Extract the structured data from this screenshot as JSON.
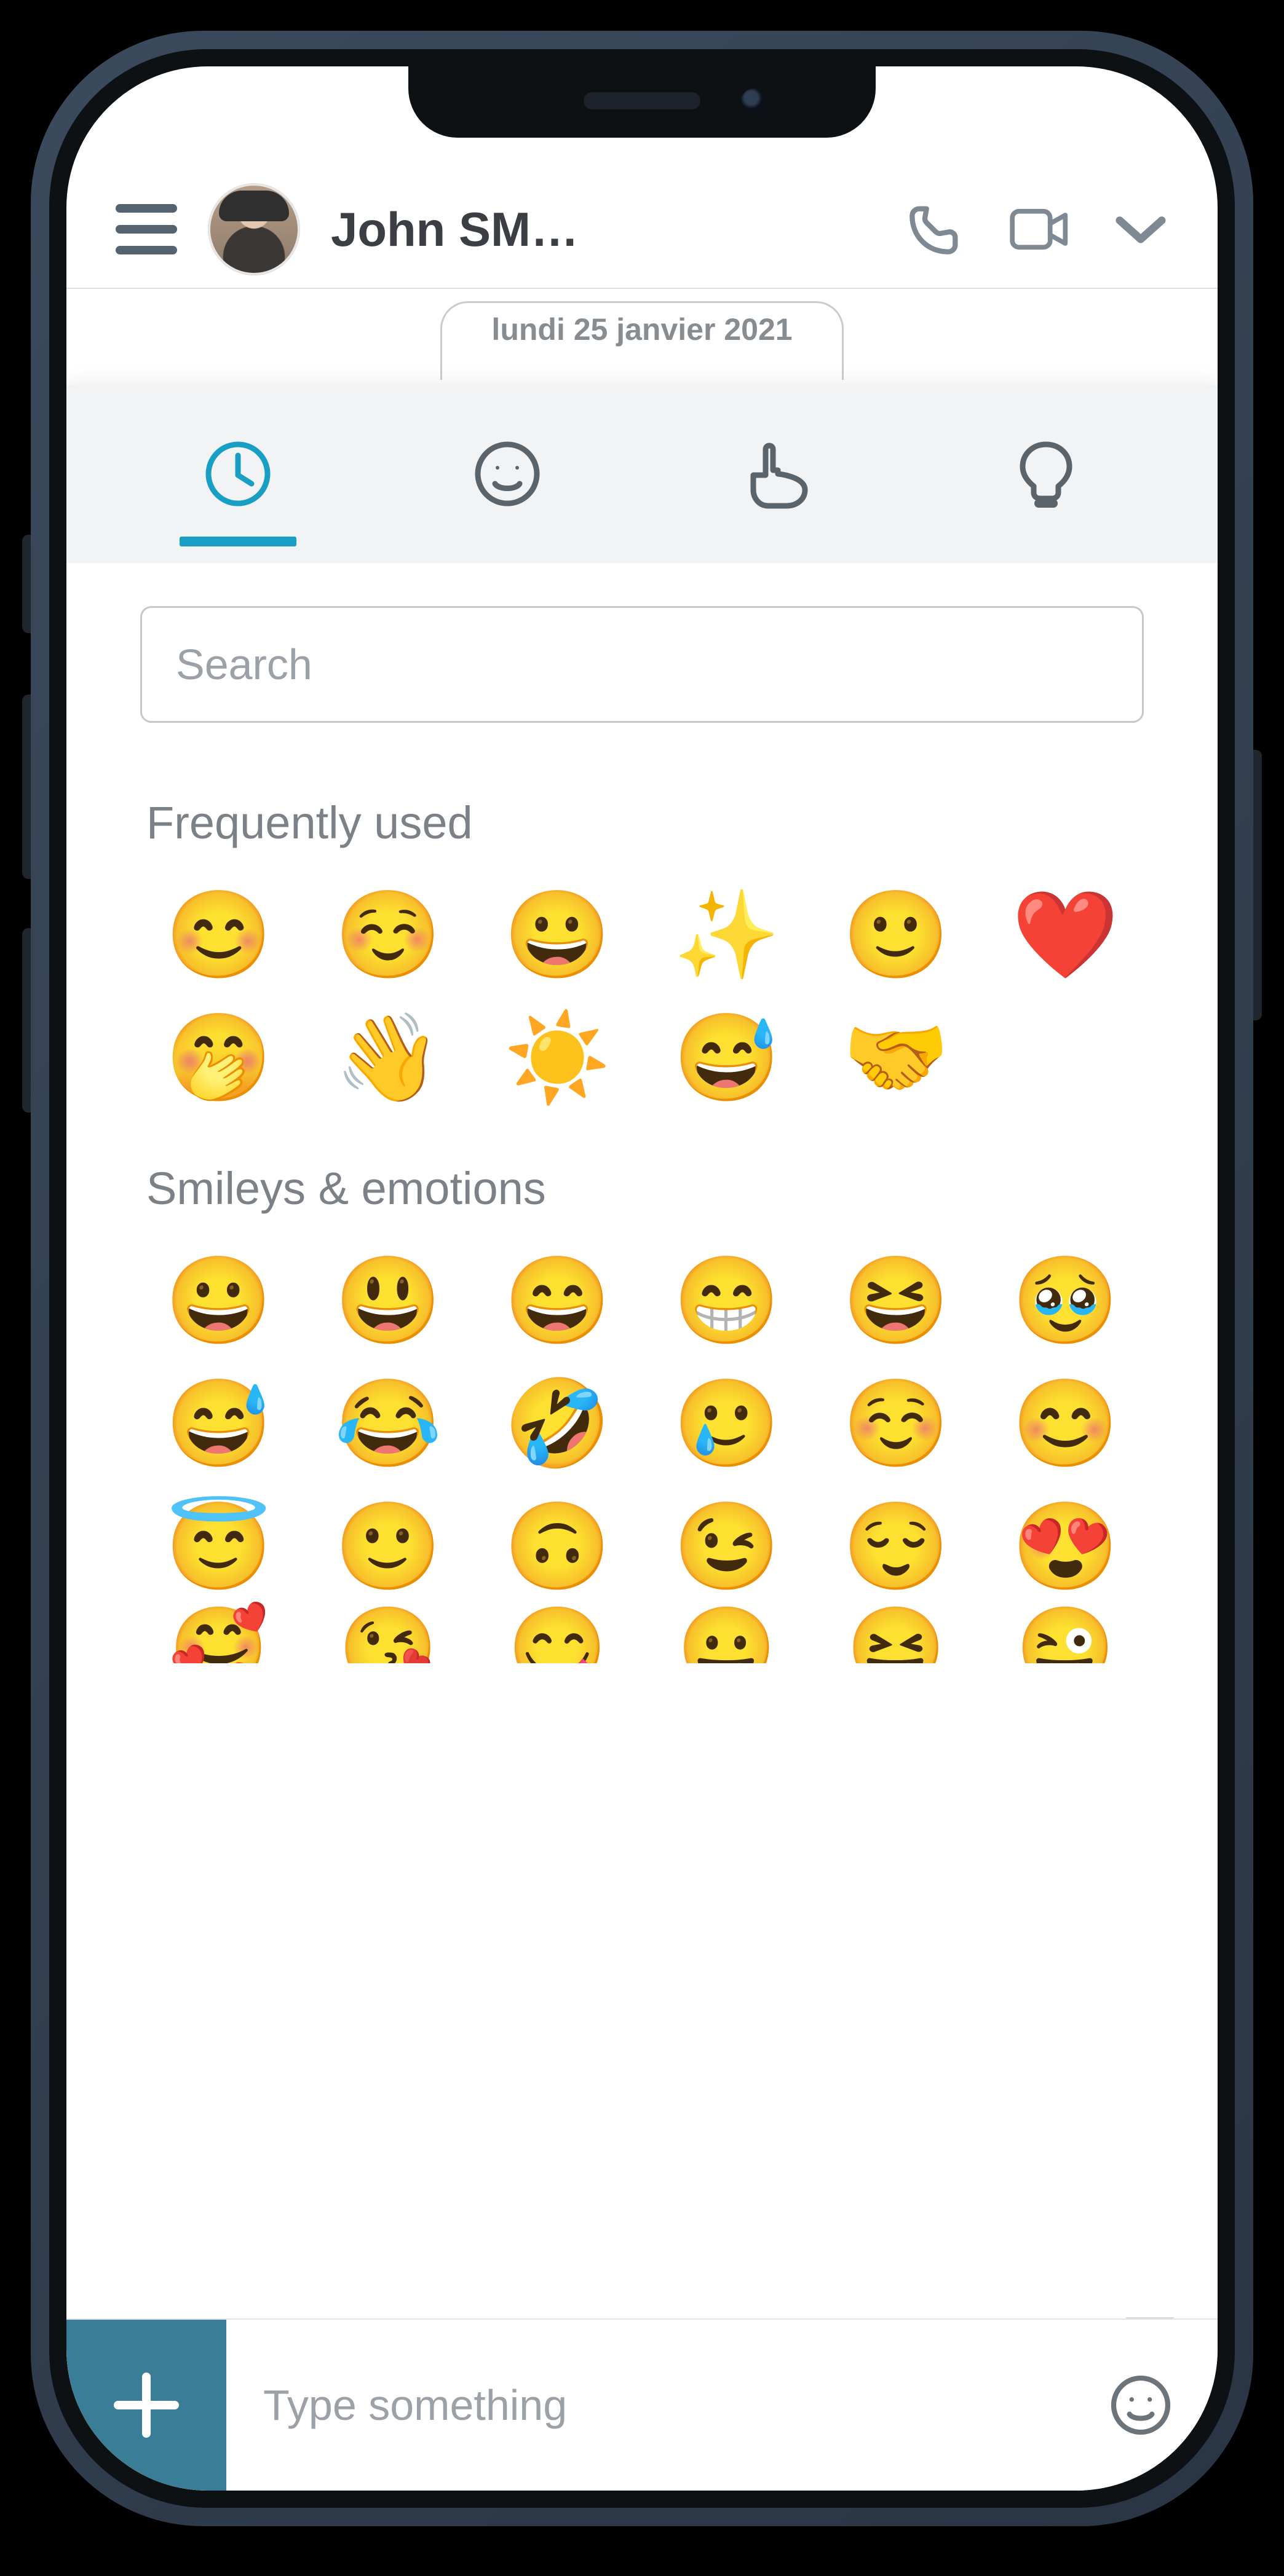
{
  "header": {
    "contact_name": "John SM…"
  },
  "date_strip": "lundi 25 janvier 2021",
  "tabs": {
    "recent": "recent",
    "smileys": "smileys",
    "gestures": "gestures",
    "objects": "objects"
  },
  "search": {
    "placeholder": "Search"
  },
  "sections": {
    "frequent_title": "Frequently used",
    "frequent": [
      "😊",
      "☺️",
      "😀",
      "✨",
      "🙂",
      "❤️",
      "🤭",
      "👋",
      "☀️",
      "😅",
      "🤝"
    ],
    "smileys_title": "Smileys & emotions",
    "smileys_rows": [
      [
        "😀",
        "😃",
        "😄",
        "😁",
        "😆",
        "🥹"
      ],
      [
        "😅",
        "😂",
        "🤣",
        "🥲",
        "☺️",
        "😊"
      ],
      [
        "😇",
        "🙂",
        "🙃",
        "😉",
        "😌",
        "😍"
      ],
      [
        "🥰",
        "😘",
        "😋",
        "😛",
        "😝",
        "😜"
      ]
    ]
  },
  "composer": {
    "placeholder": "Type something"
  }
}
